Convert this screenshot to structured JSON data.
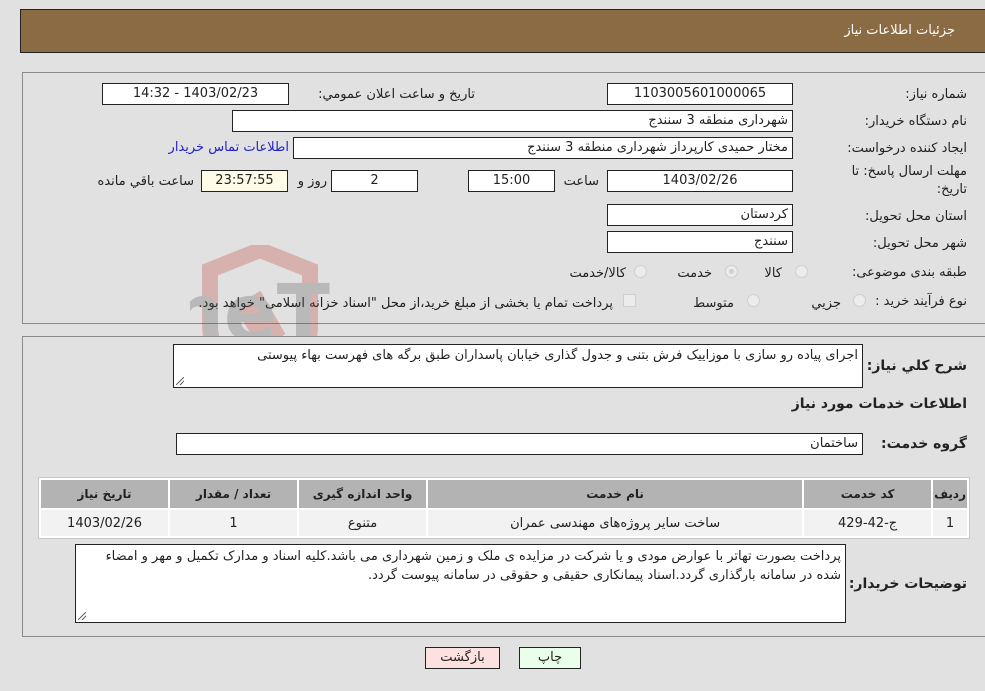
{
  "header": {
    "title": "جزئیات اطلاعات نیاز"
  },
  "form": {
    "need_number_label": "شماره نیاز:",
    "need_number": "1103005601000065",
    "announce_label": "تاريخ و ساعت اعلان عمومي:",
    "announce_value": "1403/02/23 - 14:32",
    "buyer_org_label": "نام دستگاه خریدار:",
    "buyer_org": "شهرداری منطقه 3 سنندج",
    "creator_label": "ایجاد کننده درخواست:",
    "creator": "مختار حمیدی کارپرداز شهرداری منطقه 3 سنندج",
    "contact_link": "اطلاعات تماس خریدار",
    "deadline_label_line1": "مهلت ارسال پاسخ: تا",
    "deadline_label_line2": "تاریخ:",
    "deadline_date": "1403/02/26",
    "time_label": "ساعت",
    "deadline_time": "15:00",
    "days": "2",
    "days_label": "روز و",
    "remaining_time": "23:57:55",
    "remaining_label": "ساعت باقي مانده",
    "province_label": "استان محل تحویل:",
    "province": "کردستان",
    "city_label": "شهر محل تحویل:",
    "city": "سنندج",
    "category_label": "طبقه بندی موضوعی:",
    "category_options": [
      {
        "label": "کالا",
        "selected": false
      },
      {
        "label": "خدمت",
        "selected": true
      },
      {
        "label": "کالا/خدمت",
        "selected": false
      }
    ],
    "process_label": "نوع فرآیند خرید :",
    "process_options": [
      {
        "label": "جزيي",
        "selected": false
      },
      {
        "label": "متوسط",
        "selected": false
      }
    ],
    "treasury_checkbox_label": "پرداخت تمام یا بخشی از مبلغ خرید،از محل \"اسناد خزانه اسلامی\" خواهد بود.",
    "treasury_checked": false
  },
  "details": {
    "description_label": "شرح كلي نياز:",
    "description": "اجرای پیاده رو سازی با موزاییک فرش بتنی و جدول گذاری خیابان پاسداران طبق برگه های فهرست بهاء پیوستی",
    "services_heading": "اطلاعات خدمات مورد نياز",
    "service_group_label": "گروه خدمت:",
    "service_group": "ساختمان",
    "table": {
      "columns": [
        "رديف",
        "کد خدمت",
        "نام خدمت",
        "واحد اندازه گیری",
        "تعداد / مقدار",
        "تاریخ نیاز"
      ],
      "rows": [
        [
          "1",
          "ج-42-429",
          "ساخت سایر پروژه‌های مهندسی عمران",
          "متنوع",
          "1",
          "1403/02/26"
        ]
      ]
    },
    "buyer_notes_label": "توضيحات خريدار:",
    "buyer_notes": "پرداخت بصورت تهاتر با عوارض مودی و یا شرکت در مزایده ی ملک و زمین شهرداری می باشد.کلیه اسناد و مدارک تکمیل و مهر و امضاء شده در سامانه بارگذاری گردد.اسناد پیمانکاری حقیقی و حقوقی در سامانه پیوست گردد."
  },
  "buttons": {
    "print": "چاپ",
    "back": "بازگشت"
  },
  "watermark": {
    "text": "AriaTender.neT"
  },
  "colors": {
    "header": "#8b6b43",
    "back_button": "#fde0e0",
    "print_button": "#eaffea",
    "link": "#2222cc"
  }
}
